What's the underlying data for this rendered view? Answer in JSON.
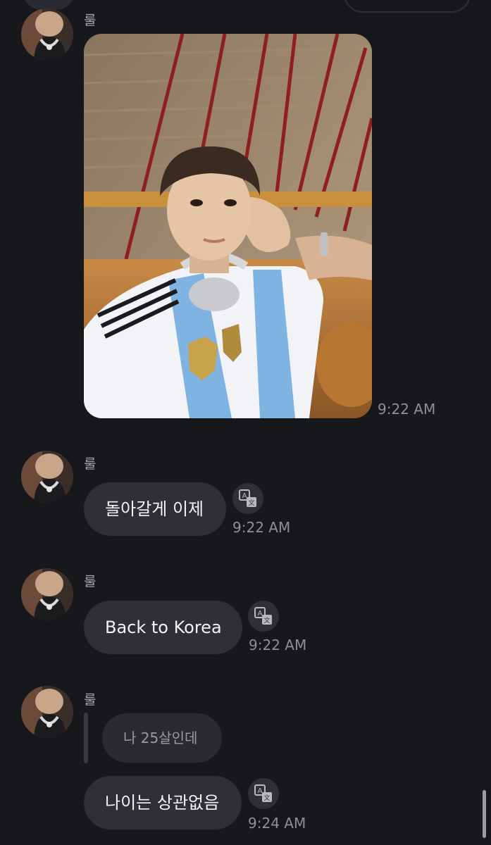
{
  "messages": [
    {
      "sender": "룰",
      "type": "image",
      "time": "9:22 AM"
    },
    {
      "sender": "룰",
      "type": "text",
      "text": "돌아갈게 이제",
      "time": "9:22 AM"
    },
    {
      "sender": "룰",
      "type": "text",
      "text": "Back to Korea",
      "time": "9:22 AM"
    },
    {
      "sender": "룰",
      "type": "reply",
      "quoted": "나 25살인데",
      "text": "나이는 상관없음",
      "time": "9:24 AM"
    }
  ],
  "icons": {
    "translate": "translate-icon",
    "avatar": "profile-avatar"
  },
  "colors": {
    "background": "#17181c",
    "bubble": "#2f3036",
    "quoted_bubble": "#2a2b31",
    "timestamp": "#8e8f95",
    "sender_name": "#a9aab0"
  }
}
